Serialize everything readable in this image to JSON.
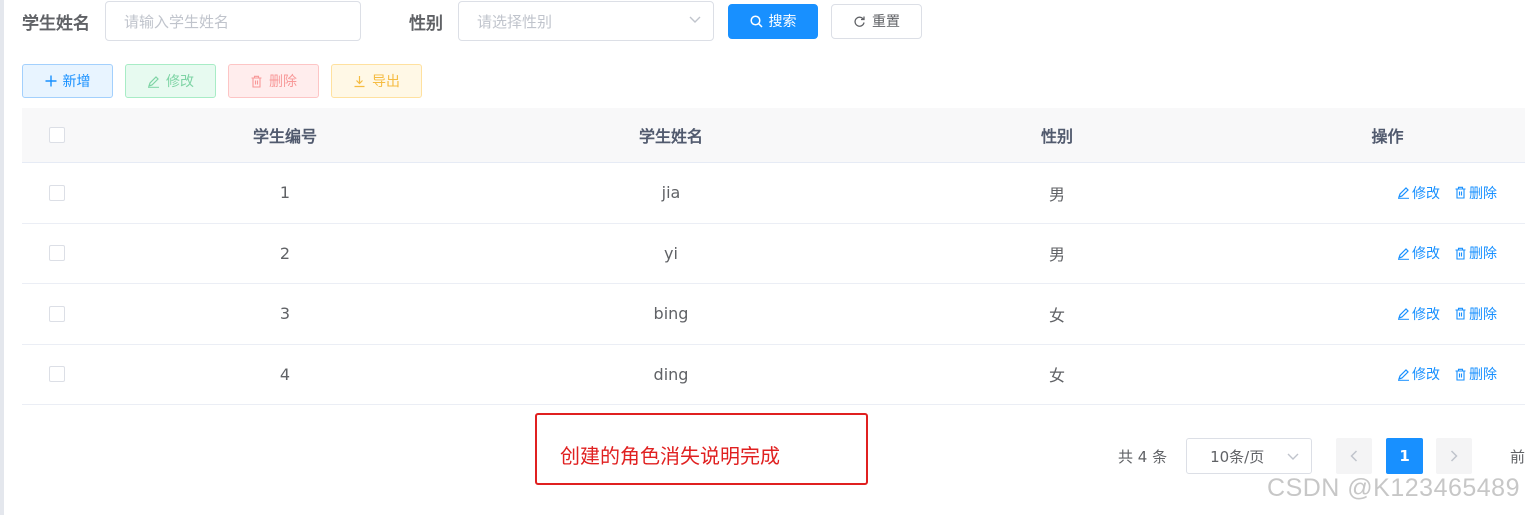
{
  "search": {
    "name_label": "学生姓名",
    "name_placeholder": "请输入学生姓名",
    "gender_label": "性别",
    "gender_placeholder": "请选择性别",
    "search_button": "搜索",
    "reset_button": "重置"
  },
  "toolbar": {
    "add": "新增",
    "edit": "修改",
    "delete": "删除",
    "export": "导出"
  },
  "table": {
    "headers": [
      "学生编号",
      "学生姓名",
      "性别",
      "操作"
    ],
    "rows": [
      {
        "id": "1",
        "name": "jia",
        "gender": "男"
      },
      {
        "id": "2",
        "name": "yi",
        "gender": "男"
      },
      {
        "id": "3",
        "name": "bing",
        "gender": "女"
      },
      {
        "id": "4",
        "name": "ding",
        "gender": "女"
      }
    ],
    "row_actions": {
      "edit": "修改",
      "delete": "删除"
    }
  },
  "annotation": {
    "text": "创建的角色消失说明完成",
    "color": "#e02020"
  },
  "pagination": {
    "total": "共 4 条",
    "page_size": "10条/页",
    "current_page": "1",
    "goto_prefix": "前"
  },
  "watermark": "CSDN @K123465489",
  "colors": {
    "primary": "#1890ff",
    "success": "#13ce66",
    "danger": "#ff4949",
    "warning": "#ffba00"
  }
}
